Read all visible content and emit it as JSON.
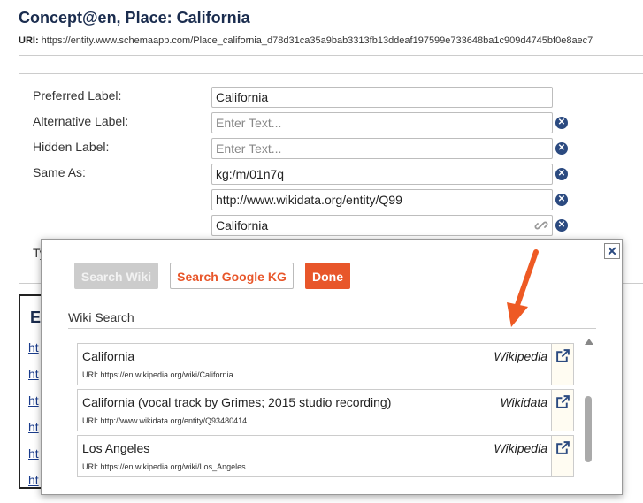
{
  "header": {
    "title": "Concept@en, Place:  California",
    "uri_label": "URI:",
    "uri_value": "https://entity.www.schemaapp.com/Place_california_d78d31ca35a9bab3313fb13ddeaf197599e733648ba1c909d4745bf0e8aec7"
  },
  "form": {
    "preferred_label": {
      "label": "Preferred Label:",
      "value": "California"
    },
    "alternative_label": {
      "label": "Alternative Label:",
      "placeholder": "Enter Text..."
    },
    "hidden_label": {
      "label": "Hidden Label:",
      "placeholder": "Enter Text..."
    },
    "same_as": {
      "label": "Same As:",
      "values": [
        "kg:/m/01n7q",
        "http://www.wikidata.org/entity/Q99",
        "California"
      ]
    },
    "truncated_label": "Ty"
  },
  "left_box": {
    "heading": "E",
    "links": [
      "ht",
      "ht",
      "ht",
      "ht",
      "ht",
      "ht"
    ]
  },
  "popup": {
    "close_glyph": "✕",
    "buttons": {
      "search_wiki": "Search Wiki",
      "search_google_kg": "Search Google KG",
      "done": "Done"
    },
    "section_title": "Wiki Search",
    "results": [
      {
        "name": "California",
        "source": "Wikipedia",
        "uri": "URI: https://en.wikipedia.org/wiki/California"
      },
      {
        "name": "California (vocal track by Grimes; 2015 studio recording)",
        "source": "Wikidata",
        "uri": "URI: http://www.wikidata.org/entity/Q93480414"
      },
      {
        "name": "Los Angeles",
        "source": "Wikipedia",
        "uri": "URI: https://en.wikipedia.org/wiki/Los_Angeles"
      }
    ]
  },
  "colors": {
    "accent": "#e8562a",
    "navy": "#1a2c4e",
    "remove_icon": "#2b4a80"
  },
  "icons": [
    "remove-icon",
    "link-icon",
    "close-icon",
    "external-link-icon",
    "annotation-arrow"
  ]
}
